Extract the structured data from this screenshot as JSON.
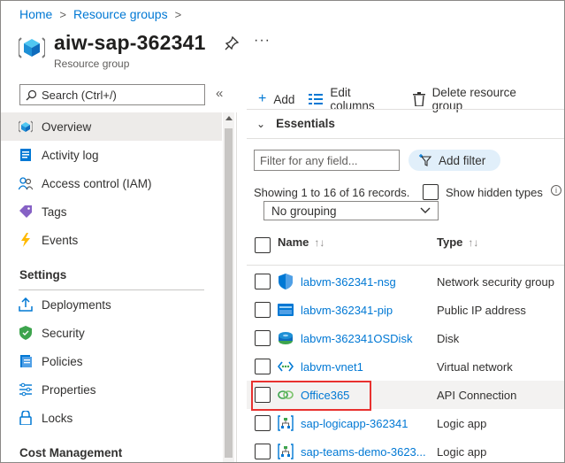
{
  "breadcrumb": {
    "home": "Home",
    "resource_groups": "Resource groups"
  },
  "header": {
    "title": "aiw-sap-362341",
    "subtitle": "Resource group",
    "more": "···",
    "icons": {
      "resource": "resource-group-cube",
      "pin": "pin"
    }
  },
  "nav": {
    "search_placeholder": "Search (Ctrl+/)",
    "collapse": "«",
    "items": [
      {
        "label": "Overview",
        "icon": "overview"
      },
      {
        "label": "Activity log",
        "icon": "activity-log"
      },
      {
        "label": "Access control (IAM)",
        "icon": "people"
      },
      {
        "label": "Tags",
        "icon": "tag"
      },
      {
        "label": "Events",
        "icon": "lightning"
      }
    ],
    "settings_heading": "Settings",
    "settings_items": [
      {
        "label": "Deployments",
        "icon": "deploy"
      },
      {
        "label": "Security",
        "icon": "shield"
      },
      {
        "label": "Policies",
        "icon": "policy"
      },
      {
        "label": "Properties",
        "icon": "properties"
      },
      {
        "label": "Locks",
        "icon": "lock"
      }
    ],
    "cost_heading": "Cost Management"
  },
  "toolbar": {
    "add": "Add",
    "edit_columns": "Edit columns",
    "delete": "Delete resource group"
  },
  "essentials": {
    "label": "Essentials",
    "chevron": "⌄"
  },
  "filter": {
    "placeholder": "Filter for any field...",
    "add_filter": "Add filter"
  },
  "records": "Showing 1 to 16 of 16 records.",
  "show_hidden": "Show hidden types",
  "info_glyph": "i",
  "grouping": "No grouping",
  "table": {
    "name_header": "Name",
    "type_header": "Type",
    "sort_glyph": "↑↓",
    "rows": [
      {
        "name": "labvm-362341-nsg",
        "type": "Network security group",
        "icon": "nsg-shield"
      },
      {
        "name": "labvm-362341-pip",
        "type": "Public IP address",
        "icon": "public-ip"
      },
      {
        "name": "labvm-362341OSDisk",
        "type": "Disk",
        "icon": "disk"
      },
      {
        "name": "labvm-vnet1",
        "type": "Virtual network",
        "icon": "vnet"
      },
      {
        "name": "Office365",
        "type": "API Connection",
        "icon": "api-connection"
      },
      {
        "name": "sap-logicapp-362341",
        "type": "Logic app",
        "icon": "logic-app"
      },
      {
        "name": "sap-teams-demo-3623...",
        "type": "Logic app",
        "icon": "logic-app"
      }
    ]
  },
  "colors": {
    "accent": "#0078d4",
    "highlight": "#e8312f",
    "selected_bg": "#edebe9"
  }
}
